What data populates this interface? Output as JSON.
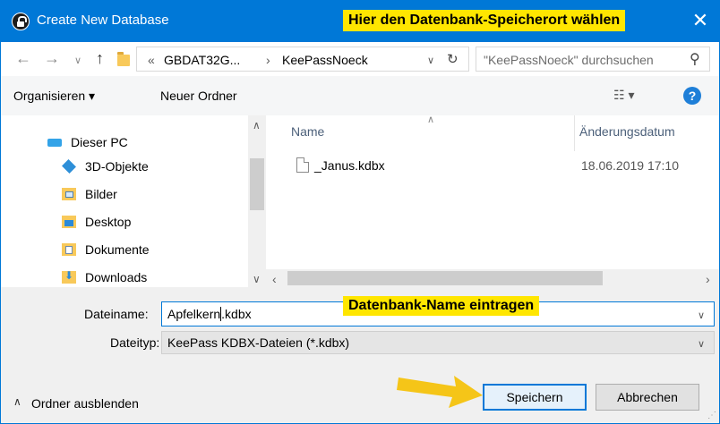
{
  "window": {
    "title": "Create New Database",
    "close_glyph": "✕"
  },
  "callouts": {
    "location": "Hier den Datenbank-Speicherort wählen",
    "name": "Datenbank-Name eintragen"
  },
  "address": {
    "overflow": "«",
    "crumbs": [
      "GBDAT32G...",
      "KeePassNoeck"
    ],
    "separator": "›",
    "search_placeholder": "\"KeePassNoeck\" durchsuchen"
  },
  "toolbar": {
    "organize_label": "Organisieren ▾",
    "new_folder_label": "Neuer Ordner",
    "view_glyph": "☷ ▾",
    "help_glyph": "?"
  },
  "nav": {
    "items": [
      {
        "label": "Dieser PC",
        "icon": "computer-icon"
      },
      {
        "label": "3D-Objekte",
        "icon": "3d-objects-icon"
      },
      {
        "label": "Bilder",
        "icon": "pictures-folder-icon"
      },
      {
        "label": "Desktop",
        "icon": "desktop-folder-icon"
      },
      {
        "label": "Dokumente",
        "icon": "documents-folder-icon"
      },
      {
        "label": "Downloads",
        "icon": "downloads-folder-icon"
      }
    ]
  },
  "files": {
    "columns": [
      "Name",
      "Änderungsdatum"
    ],
    "rows": [
      {
        "name": "_Janus.kdbx",
        "modified": "18.06.2019 17:10"
      }
    ]
  },
  "form": {
    "filename_label": "Dateiname:",
    "filename_before_caret": "Apfelkern",
    "filename_after_caret": ".kdbx",
    "filetype_label": "Dateityp:",
    "filetype_value": "KeePass KDBX-Dateien (*.kdbx)"
  },
  "footer": {
    "hide_folders_label": "Ordner ausblenden",
    "save_label": "Speichern",
    "cancel_label": "Abbrechen"
  },
  "colors": {
    "accent": "#0078d7",
    "callout": "#ffe600",
    "arrow": "#f5c518"
  }
}
